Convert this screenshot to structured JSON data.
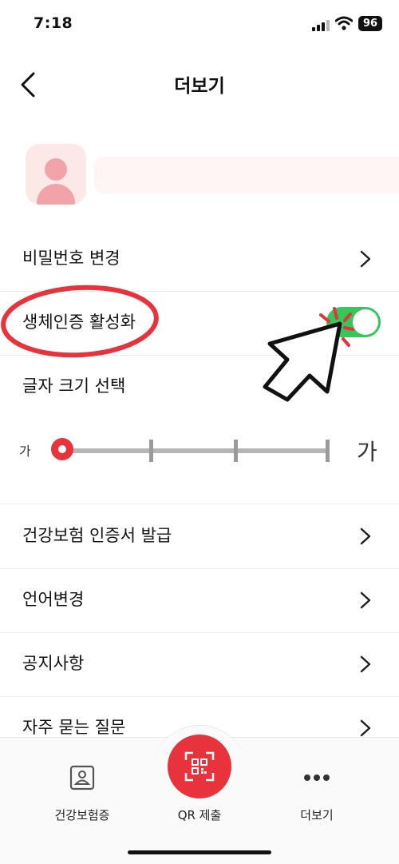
{
  "status_bar": {
    "time": "7:18",
    "battery": "96",
    "signal_icon": "cellular-signal-icon",
    "wifi_icon": "wifi-icon"
  },
  "header": {
    "title": "더보기",
    "back_icon": "chevron-left-icon"
  },
  "menu": {
    "password": "비밀번호 변경",
    "biometric": "생체인증 활성화",
    "font_size": "글자 크기 선택",
    "certificate": "건강보험 인증서 발급",
    "language": "언어변경",
    "notice": "공지사항",
    "faq": "자주 묻는 질문"
  },
  "biometric_toggle": {
    "on": true,
    "color": "#34c759"
  },
  "font_slider": {
    "small_label": "가",
    "large_label": "가",
    "steps": 4,
    "selected_step": 1,
    "accent": "#e8323c"
  },
  "tab_bar": {
    "card": "건강보험증",
    "qr": "QR 제출",
    "more": "더보기"
  },
  "colors": {
    "accent_red": "#e8323c",
    "toggle_green": "#34c759",
    "avatar_bg": "#fde8e8"
  }
}
